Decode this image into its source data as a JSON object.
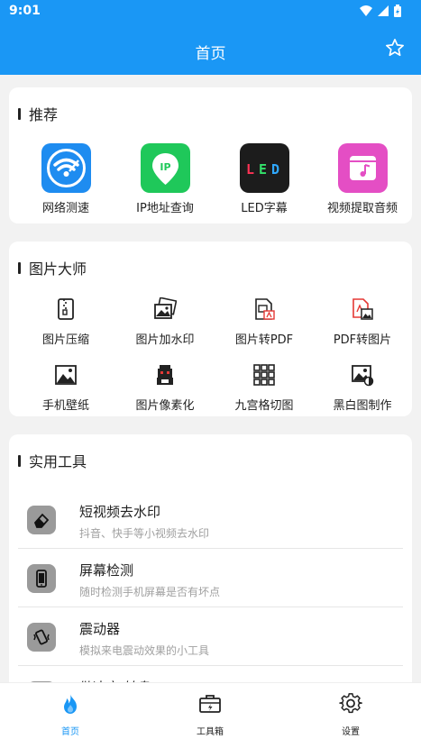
{
  "status_bar": {
    "time": "9:01"
  },
  "app_bar": {
    "title": "首页"
  },
  "recommend": {
    "title": "推荐",
    "items": [
      {
        "label": "网络测速",
        "icon": "wifi-speed-icon",
        "color": "#1e8cf0"
      },
      {
        "label": "IP地址查询",
        "icon": "ip-location-icon",
        "color": "#1fc85a"
      },
      {
        "label": "LED字幕",
        "icon": "led-icon",
        "color": "#1c1c1c"
      },
      {
        "label": "视频提取音频",
        "icon": "video-audio-icon",
        "color": "#e44ec4"
      }
    ]
  },
  "picture_master": {
    "title": "图片大师",
    "items": [
      {
        "label": "图片压缩",
        "icon": "zip-file-icon"
      },
      {
        "label": "图片加水印",
        "icon": "watermark-image-icon"
      },
      {
        "label": "图片转PDF",
        "icon": "image-to-pdf-icon"
      },
      {
        "label": "PDF转图片",
        "icon": "pdf-to-image-icon"
      },
      {
        "label": "手机壁纸",
        "icon": "wallpaper-icon"
      },
      {
        "label": "图片像素化",
        "icon": "pixel-icon"
      },
      {
        "label": "九宫格切图",
        "icon": "grid-icon"
      },
      {
        "label": "黑白图制作",
        "icon": "black-white-image-icon"
      }
    ]
  },
  "tools": {
    "title": "实用工具",
    "items": [
      {
        "title": "短视频去水印",
        "subtitle": "抖音、快手等小视频去水印",
        "icon": "eraser-icon"
      },
      {
        "title": "屏幕检测",
        "subtitle": "随时检测手机屏幕是否有坏点",
        "icon": "phone-screen-icon"
      },
      {
        "title": "震动器",
        "subtitle": "模拟来电震动效果的小工具",
        "icon": "vibrate-icon"
      },
      {
        "title": "做决定/转盘",
        "subtitle": "",
        "icon": "wheel-icon"
      }
    ]
  },
  "bottom_nav": {
    "items": [
      {
        "label": "首页",
        "icon": "flame-icon",
        "active": true
      },
      {
        "label": "工具箱",
        "icon": "toolbox-icon",
        "active": false
      },
      {
        "label": "设置",
        "icon": "settings-icon",
        "active": false
      }
    ]
  },
  "colors": {
    "primary": "#1a97f5",
    "background": "#f2f2f2"
  }
}
